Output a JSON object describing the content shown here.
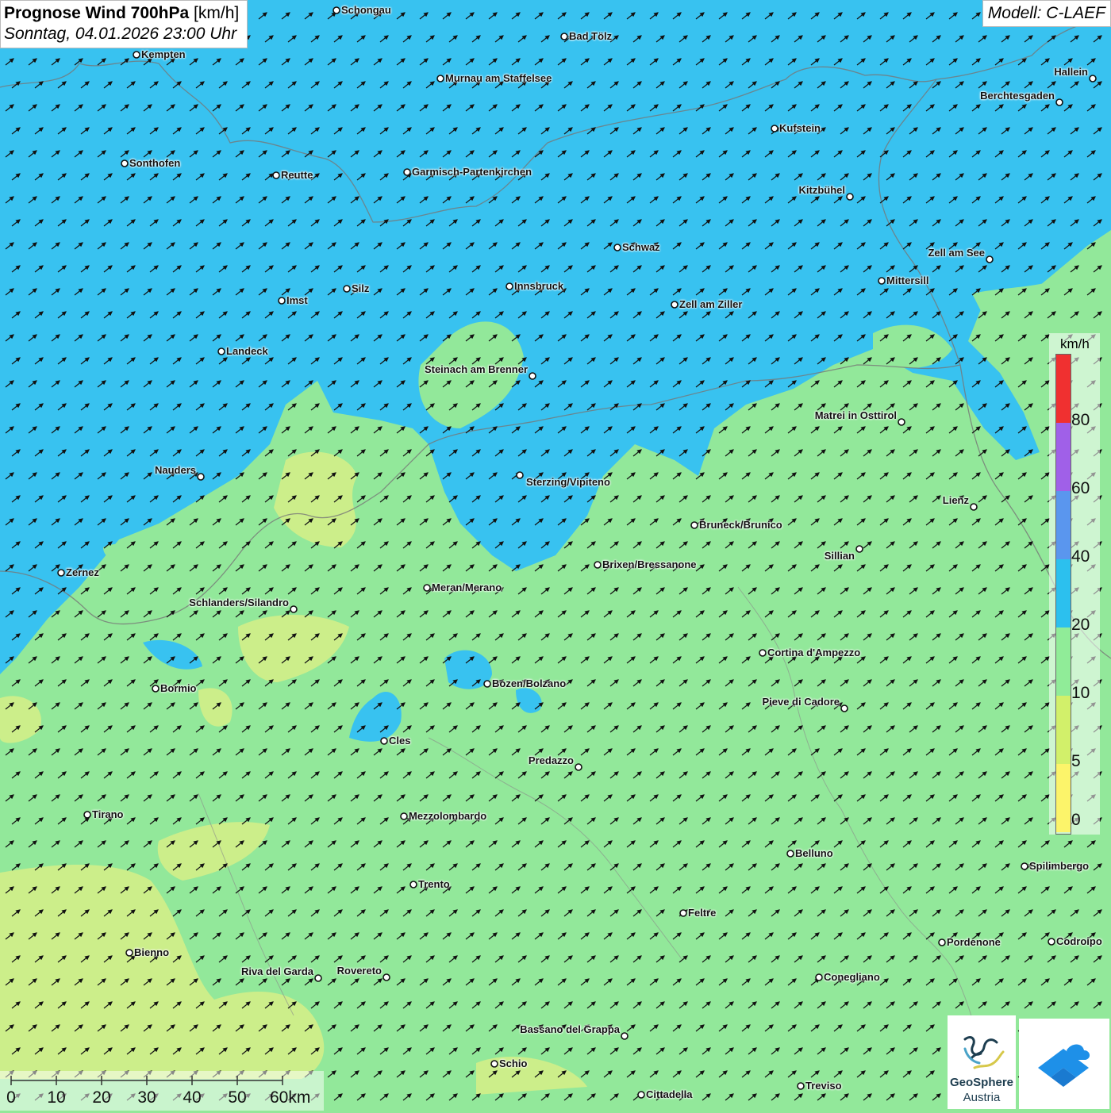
{
  "header": {
    "title_bold": "Prognose Wind 700hPa",
    "title_unit": "[km/h]",
    "datetime": "Sonntag, 04.01.2026 23:00 Uhr",
    "model": "Modell: C-LAEF"
  },
  "legend": {
    "unit": "km/h",
    "labels": [
      "80",
      "60",
      "40",
      "20",
      "10",
      "5",
      "0"
    ],
    "colors": [
      "#f03030",
      "#a060e8",
      "#5a96ee",
      "#2cc0ee",
      "#90ec98",
      "#d2f06a",
      "#fcf46a"
    ]
  },
  "scale_bar": {
    "labels": [
      "0",
      "10",
      "20",
      "30",
      "40",
      "50",
      "60km"
    ]
  },
  "logos": {
    "geosphere_line1": "GeoSphere",
    "geosphere_line2": "Austria"
  },
  "wind_direction": "southwest",
  "cities": [
    "Schongau",
    "Bad Tölz",
    "Kempten",
    "Murnau am Staffelsee",
    "Hallein",
    "Berchtesgaden",
    "Kufstein",
    "Sonthofen",
    "Reutte",
    "Garmisch-Partenkirchen",
    "Kitzbühel",
    "Schwaz",
    "Zell am See",
    "Mittersill",
    "Innsbruck",
    "Silz",
    "Imst",
    "Zell am Ziller",
    "Landeck",
    "Steinach am Brenner",
    "Matrei in Osttirol",
    "Nauders",
    "Sterzing/Vipiteno",
    "Lienz",
    "Bruneck/Brunico",
    "Sillian",
    "Brixen/Bressanone",
    "Zernez",
    "Meran/Merano",
    "Schlanders/Silandro",
    "Cortina d'Ampezzo",
    "Bozen/Bolzano",
    "Bormio",
    "Pieve di Cadore",
    "Cles",
    "Predazzo",
    "Tirano",
    "Mezzolombardo",
    "Belluno",
    "Spilimbergo",
    "Trento",
    "Feltre",
    "Pordenone",
    "Codroipo",
    "Bienno",
    "Riva del Garda",
    "Rovereto",
    "Conegliano",
    "Bassano del Grappa",
    "Schio",
    "Treviso",
    "Cittadella"
  ]
}
